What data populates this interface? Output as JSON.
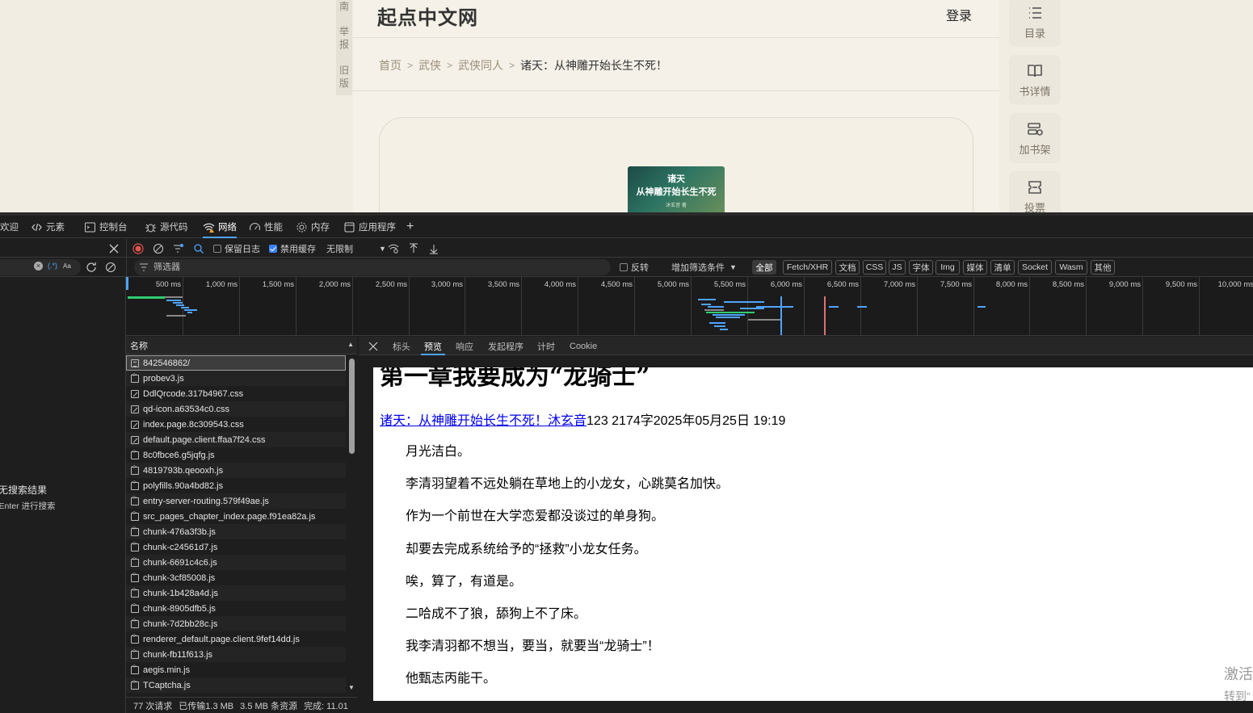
{
  "site": {
    "title": "起点中文网",
    "login": "登录",
    "left_strip": [
      "南",
      "举报",
      "旧版"
    ],
    "breadcrumb": [
      "首页",
      "武侠",
      "武侠同人",
      "诸天：从神雕开始长生不死！"
    ],
    "book_cover": {
      "line1": "诸天",
      "line2": "从神雕开始长生不死",
      "author": "沐玄音 著"
    },
    "rail": [
      {
        "label": "目录",
        "icon": "list-icon"
      },
      {
        "label": "书详情",
        "icon": "book-open-icon"
      },
      {
        "label": "加书架",
        "icon": "shelf-add-icon"
      },
      {
        "label": "投票",
        "icon": "ticket-icon"
      }
    ]
  },
  "devtools": {
    "tabs": [
      "欢迎",
      "元素",
      "控制台",
      "源代码",
      "网络",
      "性能",
      "内存",
      "应用程序"
    ],
    "active_tab": "网络",
    "toolbar": {
      "preserve_log": "保留日志",
      "disable_cache": "禁用缓存",
      "throttle": "无限制"
    },
    "filter": {
      "placeholder": "筛选器",
      "invert": "反转",
      "more_filters": "增加筛选条件",
      "types": [
        "全部",
        "Fetch/XHR",
        "文档",
        "CSS",
        "JS",
        "字体",
        "Img",
        "媒体",
        "清单",
        "Socket",
        "Wasm",
        "其他"
      ],
      "active_type": "全部"
    },
    "search": {
      "case_label": "Aa",
      "regex_label": "(.*)",
      "no_results": "无搜索结果",
      "hint": "按Enter 进行搜索"
    },
    "timeline_ticks": [
      "500 ms",
      "1,000 ms",
      "1,500 ms",
      "2,000 ms",
      "2,500 ms",
      "3,000 ms",
      "3,500 ms",
      "4,000 ms",
      "4,500 ms",
      "5,000 ms",
      "5,500 ms",
      "6,000 ms",
      "6,500 ms",
      "7,000 ms",
      "7,500 ms",
      "8,000 ms",
      "8,500 ms",
      "9,000 ms",
      "9,500 ms",
      "10,000 ms"
    ],
    "requests_header": "名称",
    "requests": [
      {
        "name": "842546862/",
        "type": "doc"
      },
      {
        "name": "probev3.js",
        "type": "js"
      },
      {
        "name": "DdlQrcode.317b4967.css",
        "type": "css"
      },
      {
        "name": "qd-icon.a63534c0.css",
        "type": "css"
      },
      {
        "name": "index.page.8c309543.css",
        "type": "css"
      },
      {
        "name": "default.page.client.ffaa7f24.css",
        "type": "css"
      },
      {
        "name": "8c0fbce6.g5jqfg.js",
        "type": "js"
      },
      {
        "name": "4819793b.qeooxh.js",
        "type": "js"
      },
      {
        "name": "polyfills.90a4bd82.js",
        "type": "js"
      },
      {
        "name": "entry-server-routing.579f49ae.js",
        "type": "js"
      },
      {
        "name": "src_pages_chapter_index.page.f91ea82a.js",
        "type": "js"
      },
      {
        "name": "chunk-476a3f3b.js",
        "type": "js"
      },
      {
        "name": "chunk-c24561d7.js",
        "type": "js"
      },
      {
        "name": "chunk-6691c4c6.js",
        "type": "js"
      },
      {
        "name": "chunk-3cf85008.js",
        "type": "js"
      },
      {
        "name": "chunk-1b428a4d.js",
        "type": "js"
      },
      {
        "name": "chunk-8905dfb5.js",
        "type": "js"
      },
      {
        "name": "chunk-7d2bb28c.js",
        "type": "js"
      },
      {
        "name": "renderer_default.page.client.9fef14dd.js",
        "type": "js"
      },
      {
        "name": "chunk-fb11f613.js",
        "type": "js"
      },
      {
        "name": "aegis.min.js",
        "type": "js"
      },
      {
        "name": "TCaptcha.js",
        "type": "js"
      }
    ],
    "selected_request": "842546862/",
    "status": {
      "requests": "77 次请求",
      "transferred": "已传输1.3 MB",
      "resources": "3.5 MB 条资源",
      "finish": "完成: 11.01"
    },
    "detail_tabs": [
      "标头",
      "预览",
      "响应",
      "发起程序",
      "计时",
      "Cookie"
    ],
    "active_detail_tab": "预览",
    "preview": {
      "chapter_title": "第一章我要成为“龙骑士”",
      "meta_link": "诸天：从神雕开始长生不死！沐玄音",
      "meta_rest": "123 2174字2025年05月25日 19:19",
      "paragraphs": [
        "月光洁白。",
        "李清羽望着不远处躺在草地上的小龙女，心跳莫名加快。",
        "作为一个前世在大学恋爱都没谈过的单身狗。",
        "却要去完成系统给予的“拯救”小龙女任务。",
        "唉，算了，有道是。",
        "二哈成不了狼，舔狗上不了床。",
        "我李清羽都不想当，要当，就要当“龙骑士”！",
        "他甄志丙能干。"
      ]
    }
  },
  "watermark": {
    "line1": "激活",
    "line2": "转到“"
  }
}
